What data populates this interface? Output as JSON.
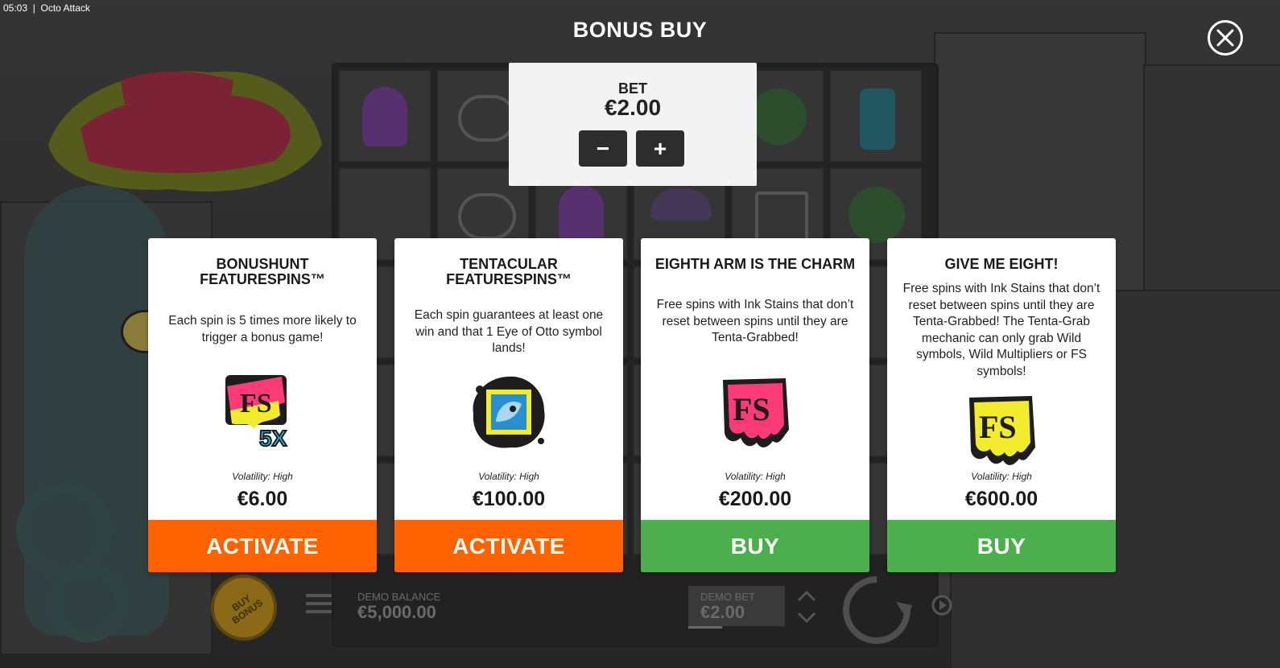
{
  "status_bar": {
    "time": "05:03",
    "app_title": "Octo Attack"
  },
  "header": {
    "title": "BONUS BUY",
    "close_icon": "close-icon"
  },
  "bet": {
    "label": "BET",
    "value": "€2.00",
    "decrease": "−",
    "increase": "+"
  },
  "cards": [
    {
      "title": "BONUSHUNT FEATURESPINS™",
      "description": "Each spin is 5 times more likely to trigger a bonus game!",
      "icon": "fs-5x-icon",
      "volatility": "Volatility: High",
      "price": "€6.00",
      "button": "ACTIVATE"
    },
    {
      "title": "TENTACULAR FEATURESPINS™",
      "description": "Each spin guarantees at least one win and that 1 Eye of Otto symbol lands!",
      "icon": "eye-of-otto-icon",
      "volatility": "Volatility: High",
      "price": "€100.00",
      "button": "ACTIVATE"
    },
    {
      "title": "EIGHTH ARM IS THE CHARM",
      "description": "Free spins with Ink Stains that don’t reset between spins until they are Tenta-Grabbed!",
      "icon": "fs-pink-icon",
      "volatility": "Volatility: High",
      "price": "€200.00",
      "button": "BUY"
    },
    {
      "title": "GIVE ME EIGHT!",
      "description": "Free spins with Ink Stains that don’t reset between spins until they are Tenta-Grabbed! The Tenta-Grab mechanic can only grab Wild symbols, Wild Multipliers or FS symbols!",
      "icon": "fs-yellow-icon",
      "volatility": "Volatility: High",
      "price": "€600.00",
      "button": "BUY"
    }
  ],
  "bottom_bar": {
    "buy_bonus": "BUY BONUS",
    "balance_label": "DEMO BALANCE",
    "balance_value": "€5,000.00",
    "bet_label": "DEMO BET",
    "bet_value": "€2.00"
  },
  "colors": {
    "activate": "#ff6200",
    "buy": "#4cae4c",
    "card_bg": "#ffffff",
    "bet_box_bg": "#f3f3f3"
  }
}
